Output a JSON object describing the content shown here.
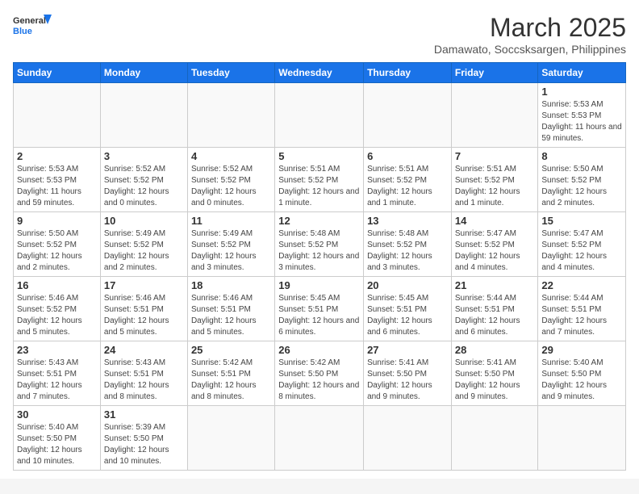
{
  "logo": {
    "text_general": "General",
    "text_blue": "Blue"
  },
  "header": {
    "month": "March 2025",
    "location": "Damawato, Soccsksargen, Philippines"
  },
  "weekdays": [
    "Sunday",
    "Monday",
    "Tuesday",
    "Wednesday",
    "Thursday",
    "Friday",
    "Saturday"
  ],
  "weeks": [
    [
      {
        "day": "",
        "info": ""
      },
      {
        "day": "",
        "info": ""
      },
      {
        "day": "",
        "info": ""
      },
      {
        "day": "",
        "info": ""
      },
      {
        "day": "",
        "info": ""
      },
      {
        "day": "",
        "info": ""
      },
      {
        "day": "1",
        "info": "Sunrise: 5:53 AM\nSunset: 5:53 PM\nDaylight: 11 hours and 59 minutes."
      }
    ],
    [
      {
        "day": "2",
        "info": "Sunrise: 5:53 AM\nSunset: 5:53 PM\nDaylight: 11 hours and 59 minutes."
      },
      {
        "day": "3",
        "info": "Sunrise: 5:52 AM\nSunset: 5:52 PM\nDaylight: 12 hours and 0 minutes."
      },
      {
        "day": "4",
        "info": "Sunrise: 5:52 AM\nSunset: 5:52 PM\nDaylight: 12 hours and 0 minutes."
      },
      {
        "day": "5",
        "info": "Sunrise: 5:51 AM\nSunset: 5:52 PM\nDaylight: 12 hours and 1 minute."
      },
      {
        "day": "6",
        "info": "Sunrise: 5:51 AM\nSunset: 5:52 PM\nDaylight: 12 hours and 1 minute."
      },
      {
        "day": "7",
        "info": "Sunrise: 5:51 AM\nSunset: 5:52 PM\nDaylight: 12 hours and 1 minute."
      },
      {
        "day": "8",
        "info": "Sunrise: 5:50 AM\nSunset: 5:52 PM\nDaylight: 12 hours and 2 minutes."
      }
    ],
    [
      {
        "day": "9",
        "info": "Sunrise: 5:50 AM\nSunset: 5:52 PM\nDaylight: 12 hours and 2 minutes."
      },
      {
        "day": "10",
        "info": "Sunrise: 5:49 AM\nSunset: 5:52 PM\nDaylight: 12 hours and 2 minutes."
      },
      {
        "day": "11",
        "info": "Sunrise: 5:49 AM\nSunset: 5:52 PM\nDaylight: 12 hours and 3 minutes."
      },
      {
        "day": "12",
        "info": "Sunrise: 5:48 AM\nSunset: 5:52 PM\nDaylight: 12 hours and 3 minutes."
      },
      {
        "day": "13",
        "info": "Sunrise: 5:48 AM\nSunset: 5:52 PM\nDaylight: 12 hours and 3 minutes."
      },
      {
        "day": "14",
        "info": "Sunrise: 5:47 AM\nSunset: 5:52 PM\nDaylight: 12 hours and 4 minutes."
      },
      {
        "day": "15",
        "info": "Sunrise: 5:47 AM\nSunset: 5:52 PM\nDaylight: 12 hours and 4 minutes."
      }
    ],
    [
      {
        "day": "16",
        "info": "Sunrise: 5:46 AM\nSunset: 5:52 PM\nDaylight: 12 hours and 5 minutes."
      },
      {
        "day": "17",
        "info": "Sunrise: 5:46 AM\nSunset: 5:51 PM\nDaylight: 12 hours and 5 minutes."
      },
      {
        "day": "18",
        "info": "Sunrise: 5:46 AM\nSunset: 5:51 PM\nDaylight: 12 hours and 5 minutes."
      },
      {
        "day": "19",
        "info": "Sunrise: 5:45 AM\nSunset: 5:51 PM\nDaylight: 12 hours and 6 minutes."
      },
      {
        "day": "20",
        "info": "Sunrise: 5:45 AM\nSunset: 5:51 PM\nDaylight: 12 hours and 6 minutes."
      },
      {
        "day": "21",
        "info": "Sunrise: 5:44 AM\nSunset: 5:51 PM\nDaylight: 12 hours and 6 minutes."
      },
      {
        "day": "22",
        "info": "Sunrise: 5:44 AM\nSunset: 5:51 PM\nDaylight: 12 hours and 7 minutes."
      }
    ],
    [
      {
        "day": "23",
        "info": "Sunrise: 5:43 AM\nSunset: 5:51 PM\nDaylight: 12 hours and 7 minutes."
      },
      {
        "day": "24",
        "info": "Sunrise: 5:43 AM\nSunset: 5:51 PM\nDaylight: 12 hours and 8 minutes."
      },
      {
        "day": "25",
        "info": "Sunrise: 5:42 AM\nSunset: 5:51 PM\nDaylight: 12 hours and 8 minutes."
      },
      {
        "day": "26",
        "info": "Sunrise: 5:42 AM\nSunset: 5:50 PM\nDaylight: 12 hours and 8 minutes."
      },
      {
        "day": "27",
        "info": "Sunrise: 5:41 AM\nSunset: 5:50 PM\nDaylight: 12 hours and 9 minutes."
      },
      {
        "day": "28",
        "info": "Sunrise: 5:41 AM\nSunset: 5:50 PM\nDaylight: 12 hours and 9 minutes."
      },
      {
        "day": "29",
        "info": "Sunrise: 5:40 AM\nSunset: 5:50 PM\nDaylight: 12 hours and 9 minutes."
      }
    ],
    [
      {
        "day": "30",
        "info": "Sunrise: 5:40 AM\nSunset: 5:50 PM\nDaylight: 12 hours and 10 minutes."
      },
      {
        "day": "31",
        "info": "Sunrise: 5:39 AM\nSunset: 5:50 PM\nDaylight: 12 hours and 10 minutes."
      },
      {
        "day": "",
        "info": ""
      },
      {
        "day": "",
        "info": ""
      },
      {
        "day": "",
        "info": ""
      },
      {
        "day": "",
        "info": ""
      },
      {
        "day": "",
        "info": ""
      }
    ]
  ]
}
